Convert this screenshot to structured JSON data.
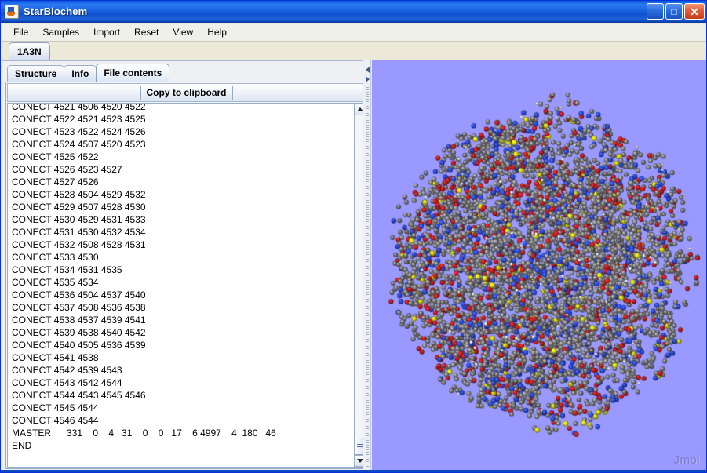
{
  "window": {
    "title": "StarBiochem",
    "icon": "java-coffee-cup-icon",
    "controls": {
      "minimize_label": "_",
      "maximize_label": "□",
      "close_label": "✕"
    }
  },
  "menu": {
    "items": [
      {
        "label": "File"
      },
      {
        "label": "Samples"
      },
      {
        "label": "Import"
      },
      {
        "label": "Reset"
      },
      {
        "label": "View"
      },
      {
        "label": "Help"
      }
    ]
  },
  "outer_tabs": [
    {
      "label": "1A3N",
      "selected": true
    }
  ],
  "inner_tabs": [
    {
      "label": "Structure",
      "selected": false
    },
    {
      "label": "Info",
      "selected": false
    },
    {
      "label": "File contents",
      "selected": true
    }
  ],
  "toolbar": {
    "copy_label": "Copy to clipboard"
  },
  "file_contents": {
    "lines": [
      "CONECT 4521 4506 4520 4522",
      "CONECT 4522 4521 4523 4525",
      "CONECT 4523 4522 4524 4526",
      "CONECT 4524 4507 4520 4523",
      "CONECT 4525 4522",
      "CONECT 4526 4523 4527",
      "CONECT 4527 4526",
      "CONECT 4528 4504 4529 4532",
      "CONECT 4529 4507 4528 4530",
      "CONECT 4530 4529 4531 4533",
      "CONECT 4531 4530 4532 4534",
      "CONECT 4532 4508 4528 4531",
      "CONECT 4533 4530",
      "CONECT 4534 4531 4535",
      "CONECT 4535 4534",
      "CONECT 4536 4504 4537 4540",
      "CONECT 4537 4508 4536 4538",
      "CONECT 4538 4537 4539 4541",
      "CONECT 4539 4538 4540 4542",
      "CONECT 4540 4505 4536 4539",
      "CONECT 4541 4538",
      "CONECT 4542 4539 4543",
      "CONECT 4543 4542 4544",
      "CONECT 4544 4543 4545 4546",
      "CONECT 4545 4544",
      "CONECT 4546 4544",
      "MASTER      331    0    4   31    0    0   17    6 4997    4  180   46",
      "END"
    ]
  },
  "scrollbar": {
    "up_arrow": "scroll-up-icon",
    "down_arrow": "scroll-down-icon",
    "thumb_position": "bottom"
  },
  "splitter": {
    "collapse_left_icon": "arrow-left-icon",
    "expand_right_icon": "arrow-right-icon"
  },
  "viewer": {
    "watermark": "Jmol",
    "background_color": "#9999ff",
    "molecule": "1A3N",
    "atom_colors": {
      "carbon": "#8a8a8a",
      "oxygen": "#e02020",
      "nitrogen": "#3050f8",
      "sulfur": "#f2f211",
      "hydrogen": "#ffffff"
    }
  },
  "colors": {
    "titlebar_blue": "#0a56d8",
    "close_red": "#c93c18",
    "panel_bg": "#eef0f4",
    "text_bg": "#ffffff"
  }
}
